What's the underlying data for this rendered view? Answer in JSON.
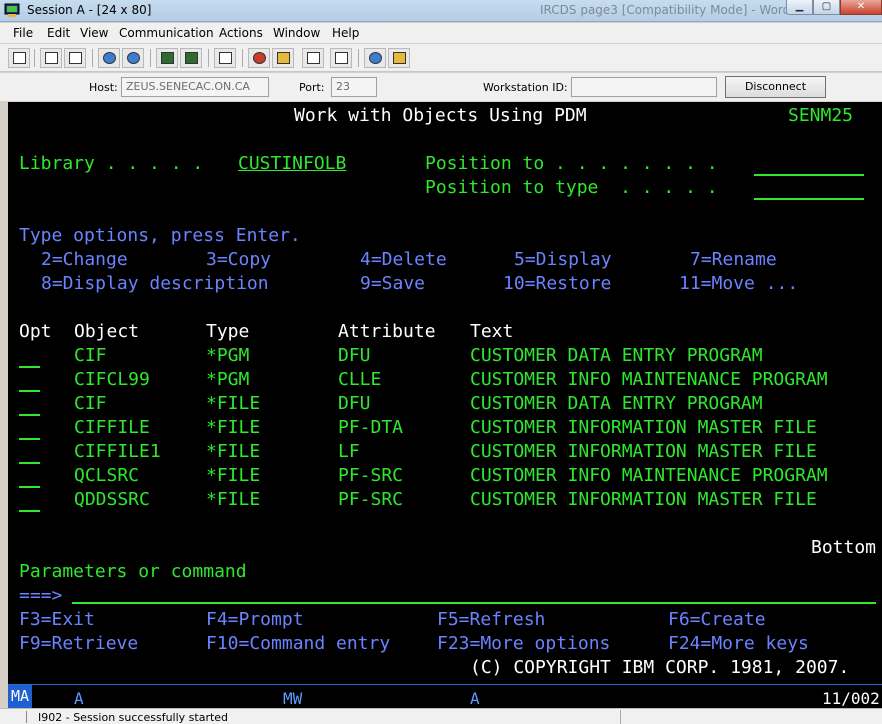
{
  "window": {
    "title": "Session A - [24 x 80]",
    "ghost_title": "IRCDS page3 [Compatibility Mode] - Word"
  },
  "menu": [
    "File",
    "Edit",
    "View",
    "Communication",
    "Actions",
    "Window",
    "Help"
  ],
  "toolbar_icons": [
    "print-screen-icon",
    "copy-icon",
    "paste-icon",
    "send-icon",
    "receive-icon",
    "display-icon",
    "color-icon",
    "map-icon",
    "record-icon",
    "play-icon",
    "macro-icon",
    "stop-icon",
    "globe-icon",
    "help-icon"
  ],
  "hostbar": {
    "host_label": "Host:",
    "host_value": "ZEUS.SENECAC.ON.CA",
    "port_label": "Port:",
    "port_value": "23",
    "workstation_label": "Workstation ID:",
    "workstation_value": "",
    "disconnect_label": "Disconnect"
  },
  "screen": {
    "title": "Work with Objects Using PDM",
    "system": "SENM25",
    "library_label": "Library . . . . .",
    "library_value": "CUSTINFOLB",
    "position_to_label": "Position to . . . . . . . .",
    "position_to_type_label": "Position to type  . . . . .",
    "instructions": "Type options, press Enter.",
    "options_line1": [
      "2=Change",
      "3=Copy",
      "4=Delete",
      "5=Display",
      "7=Rename"
    ],
    "options_line2": [
      "8=Display description",
      "9=Save",
      "10=Restore",
      "11=Move ..."
    ],
    "columns": [
      "Opt",
      "Object",
      "Type",
      "Attribute",
      "Text"
    ],
    "rows": [
      {
        "object": "CIF",
        "type": "*PGM",
        "attribute": "DFU",
        "text": "CUSTOMER DATA ENTRY PROGRAM"
      },
      {
        "object": "CIFCL99",
        "type": "*PGM",
        "attribute": "CLLE",
        "text": "CUSTOMER INFO MAINTENANCE PROGRAM"
      },
      {
        "object": "CIF",
        "type": "*FILE",
        "attribute": "DFU",
        "text": "CUSTOMER DATA ENTRY PROGRAM"
      },
      {
        "object": "CIFFILE",
        "type": "*FILE",
        "attribute": "PF-DTA",
        "text": "CUSTOMER INFORMATION MASTER FILE"
      },
      {
        "object": "CIFFILE1",
        "type": "*FILE",
        "attribute": "LF",
        "text": "CUSTOMER INFORMATION MASTER FILE"
      },
      {
        "object": "QCLSRC",
        "type": "*FILE",
        "attribute": "PF-SRC",
        "text": "CUSTOMER INFO MAINTENANCE PROGRAM"
      },
      {
        "object": "QDDSSRC",
        "type": "*FILE",
        "attribute": "PF-SRC",
        "text": "CUSTOMER INFORMATION MASTER FILE"
      }
    ],
    "bottom_indicator": "Bottom",
    "params_label": "Parameters or command",
    "prompt": "===>",
    "fkeys_line1": [
      "F3=Exit",
      "F4=Prompt",
      "F5=Refresh",
      "F6=Create"
    ],
    "fkeys_line2": [
      "F9=Retrieve",
      "F10=Command entry",
      "F23=More options",
      "F24=More keys"
    ],
    "copyright": "(C) COPYRIGHT IBM CORP. 1981, 2007."
  },
  "oia": {
    "session_indicator": "MA",
    "field1": "A",
    "field2": "MW",
    "field3": "A",
    "cursor_pos": "11/002"
  },
  "status_message": "I902 - Session successfully started",
  "colors": {
    "terminal_bg": "#000000",
    "green": "#2ee82e",
    "white": "#ffffff",
    "blue": "#6b83ff",
    "oia_blue": "#1f5fd0"
  }
}
